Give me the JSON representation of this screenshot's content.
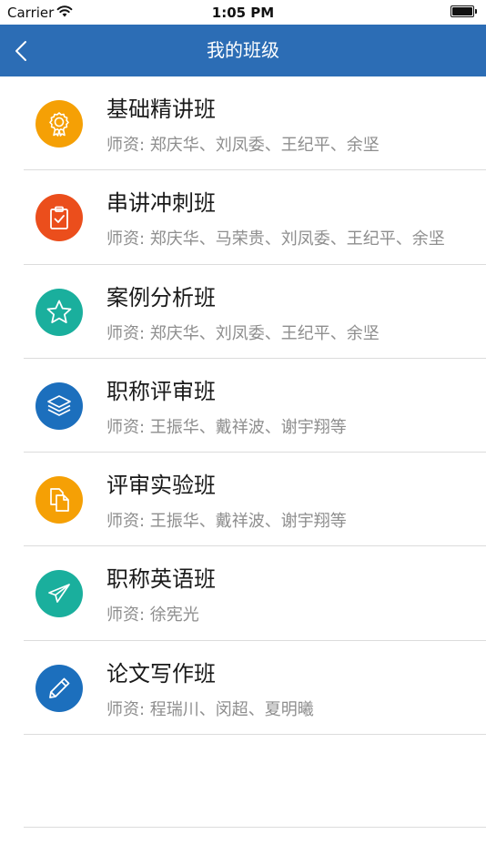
{
  "status_bar": {
    "carrier": "Carrier",
    "time": "1:05 PM"
  },
  "nav": {
    "title": "我的班级",
    "back_icon": "chevron-left-icon"
  },
  "colors": {
    "nav_background": "#2c6db5",
    "orange": "#f5a005",
    "red_orange": "#eb4e1c",
    "teal": "#1aaf9d",
    "blue": "#1c6fbd"
  },
  "classes": [
    {
      "title": "基础精讲班",
      "teacher": "师资: 郑庆华、刘凤委、王纪平、余坚",
      "icon": "award-badge-icon",
      "color": "#f5a005"
    },
    {
      "title": "串讲冲刺班",
      "teacher": "师资: 郑庆华、马荣贵、刘凤委、王纪平、余坚",
      "icon": "clipboard-check-icon",
      "color": "#eb4e1c"
    },
    {
      "title": "案例分析班",
      "teacher": "师资: 郑庆华、刘凤委、王纪平、余坚",
      "icon": "star-icon",
      "color": "#1aaf9d"
    },
    {
      "title": "职称评审班",
      "teacher": "师资: 王振华、戴祥波、谢宇翔等",
      "icon": "layers-icon",
      "color": "#1c6fbd"
    },
    {
      "title": "评审实验班",
      "teacher": "师资: 王振华、戴祥波、谢宇翔等",
      "icon": "documents-icon",
      "color": "#f5a005"
    },
    {
      "title": "职称英语班",
      "teacher": "师资: 徐宪光",
      "icon": "paper-plane-icon",
      "color": "#1aaf9d"
    },
    {
      "title": "论文写作班",
      "teacher": "师资: 程瑞川、闵超、夏明曦",
      "icon": "pencil-icon",
      "color": "#1c6fbd"
    }
  ]
}
